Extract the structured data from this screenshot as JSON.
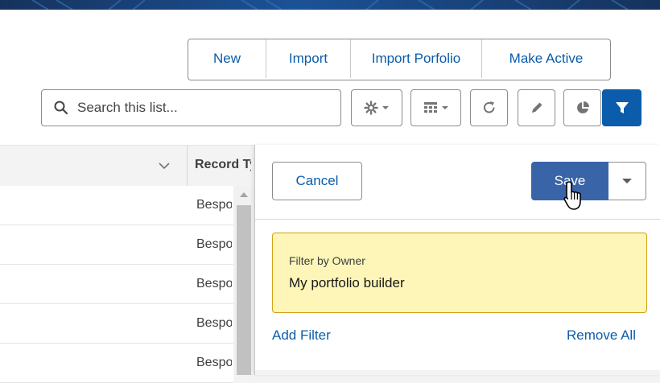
{
  "toolbar": {
    "buttons": [
      {
        "label": "New"
      },
      {
        "label": "Import"
      },
      {
        "label": "Import Porfolio"
      },
      {
        "label": "Make Active"
      }
    ],
    "search_placeholder": "Search this list...",
    "icons": [
      "gear-icon",
      "table-icon",
      "refresh-icon",
      "pencil-icon",
      "pie-chart-icon",
      "filter-icon"
    ]
  },
  "table": {
    "column_header": "Record Type",
    "rows": [
      {
        "value": "Bespoke"
      },
      {
        "value": "Bespoke"
      },
      {
        "value": "Bespoke"
      },
      {
        "value": "Bespoke"
      },
      {
        "value": "Bespoke"
      }
    ]
  },
  "filter_panel": {
    "cancel_label": "Cancel",
    "save_label": "Save",
    "filter": {
      "label": "Filter by Owner",
      "value": "My portfolio builder"
    },
    "add_filter_label": "Add Filter",
    "remove_all_label": "Remove All"
  },
  "colors": {
    "brand_blue": "#0b5cab",
    "save_blue": "#3a64a8",
    "filter_highlight": "#fdf6b8"
  }
}
